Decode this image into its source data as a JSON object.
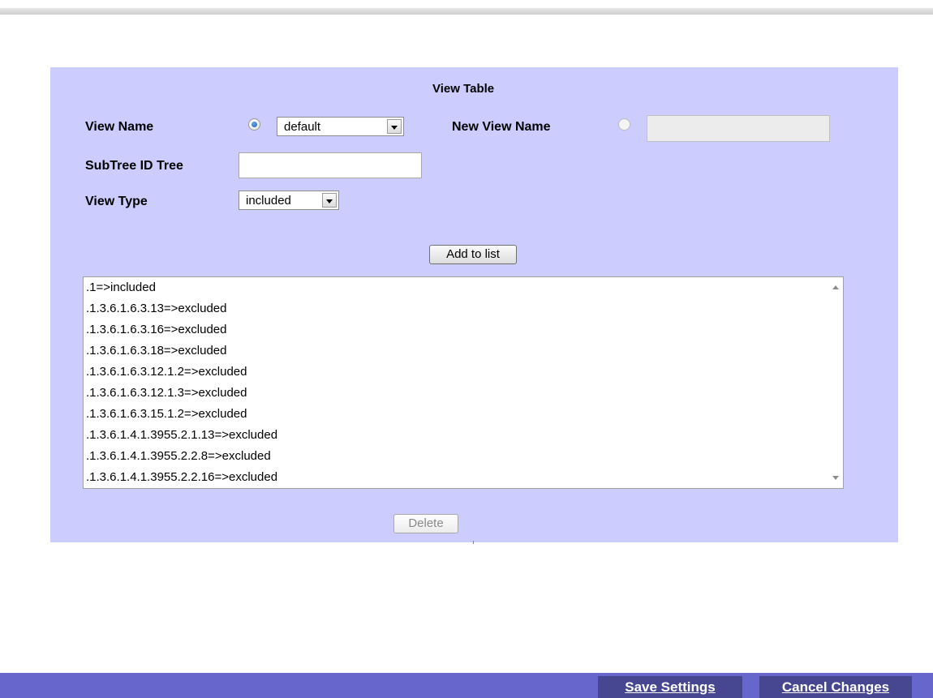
{
  "view_table": {
    "title": "View Table",
    "view_name": {
      "label": "View Name",
      "selected": "default"
    },
    "new_view_name": {
      "label": "New View Name",
      "value": ""
    },
    "subtree": {
      "label": "SubTree ID Tree",
      "value": ""
    },
    "view_type": {
      "label": "View Type",
      "selected": "included"
    },
    "add_button": "Add to list",
    "entries": [
      ".1=>included",
      ".1.3.6.1.6.3.13=>excluded",
      ".1.3.6.1.6.3.16=>excluded",
      ".1.3.6.1.6.3.18=>excluded",
      ".1.3.6.1.6.3.12.1.2=>excluded",
      ".1.3.6.1.6.3.12.1.3=>excluded",
      ".1.3.6.1.6.3.15.1.2=>excluded",
      ".1.3.6.1.4.1.3955.2.1.13=>excluded",
      ".1.3.6.1.4.1.3955.2.2.8=>excluded",
      ".1.3.6.1.4.1.3955.2.2.16=>excluded"
    ],
    "delete_button": "Delete"
  },
  "footer": {
    "save_label": "Save Settings",
    "cancel_label": "Cancel Changes"
  },
  "colors": {
    "panel_bg": "#ccccff",
    "footer_bg": "#6666cc",
    "footer_button_bg": "#474791"
  }
}
